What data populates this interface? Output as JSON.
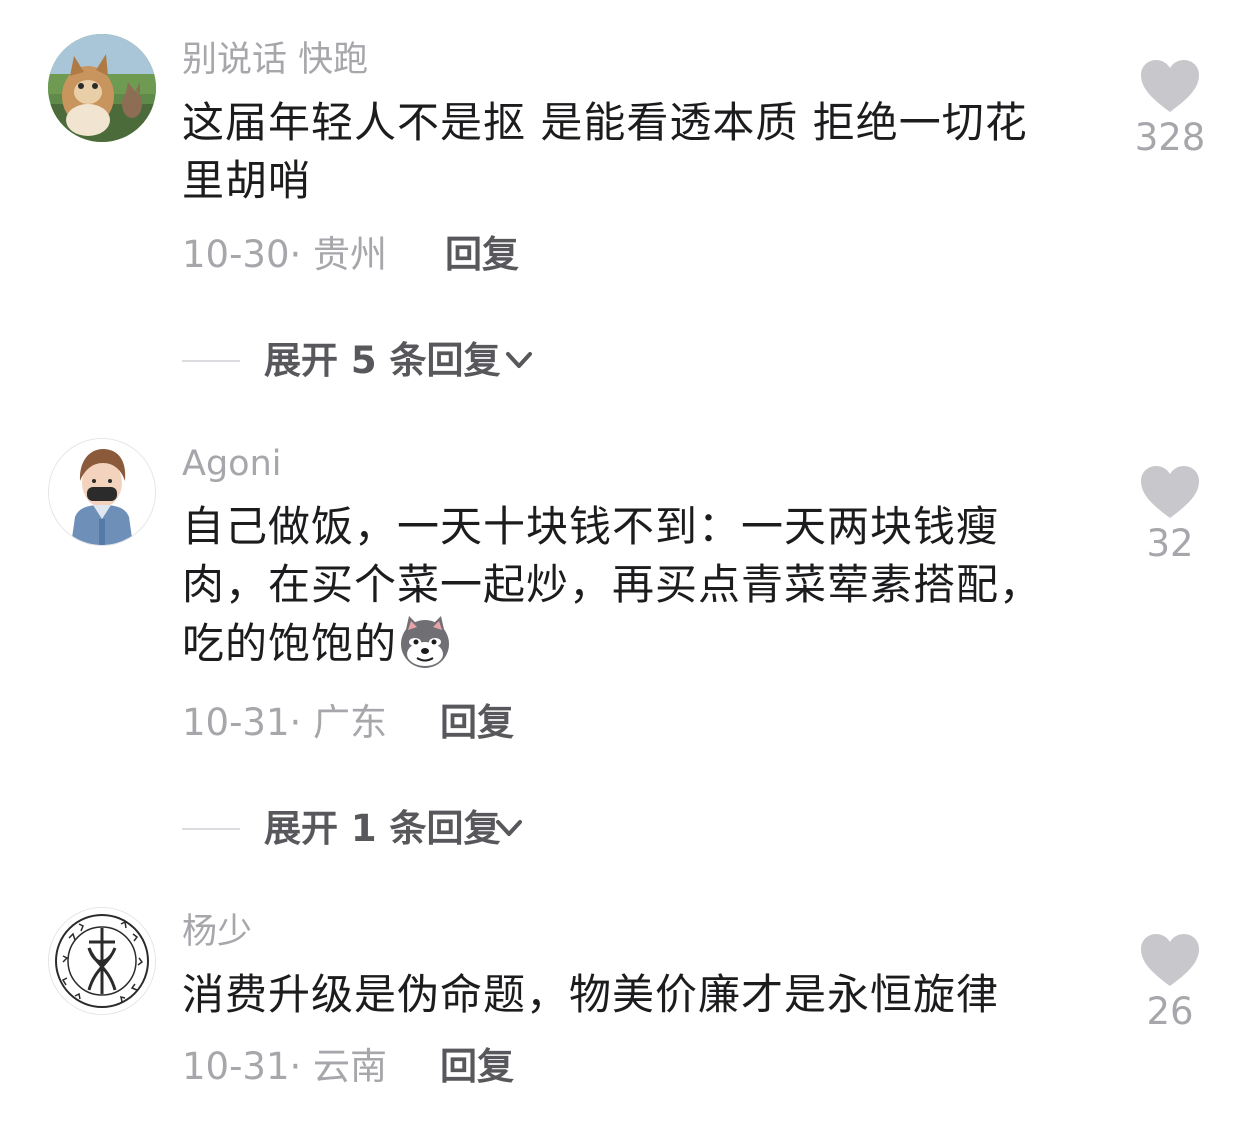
{
  "comments": [
    {
      "username": "别说话 快跑",
      "content_lines": [
        "这届年轻人不是抠 是能看透本质 拒绝一切花",
        "里胡哨"
      ],
      "date": "10-30",
      "location": "· 贵州",
      "reply_label": "回复",
      "likes": "328",
      "expand_label": "展开 5 条回复"
    },
    {
      "username": "Agoni",
      "content_lines": [
        "自己做饭，一天十块钱不到：一天两块钱瘦",
        "肉，在买个菜一起炒，再买点青菜荤素搭配，",
        "吃的饱饱的"
      ],
      "emoji": "doge-emoji",
      "date": "10-31",
      "location": "· 广东",
      "reply_label": "回复",
      "likes": "32",
      "expand_label": "展开 1 条回复"
    },
    {
      "username": "杨少",
      "content_lines": [
        "消费升级是伪命题，物美价廉才是永恒旋律"
      ],
      "date": "10-31",
      "location": "· 云南",
      "reply_label": "回复",
      "likes": "26"
    }
  ],
  "icons": {
    "like": "heart-icon",
    "expand": "chevron-down-icon"
  },
  "colors": {
    "text_primary": "#1c1c1e",
    "text_secondary": "#a6a6ab",
    "text_action": "#58585c",
    "heart": "#c8c8cc"
  }
}
